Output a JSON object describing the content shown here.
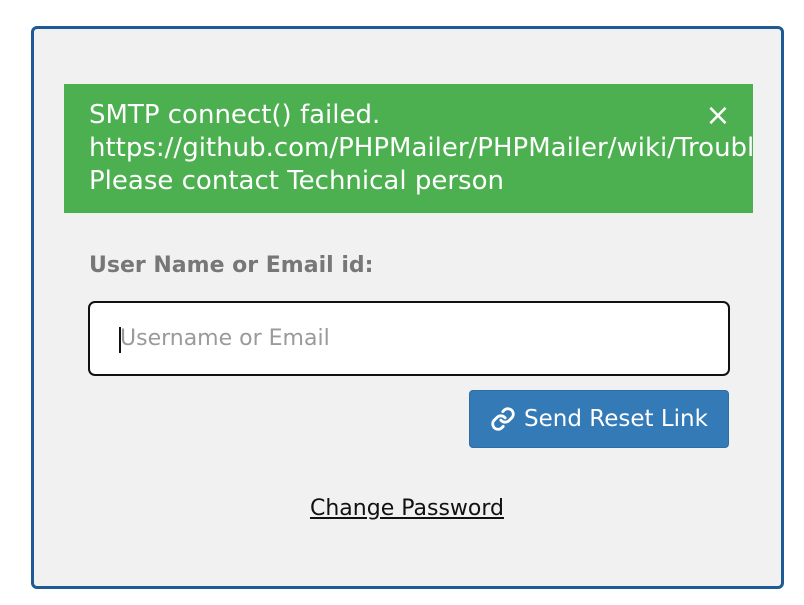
{
  "alert": {
    "lines": [
      "SMTP connect() failed.",
      "https://github.com/PHPMailer/PHPMailer/wiki/Troubleshooting",
      "Please contact Technical person"
    ],
    "close_label": "×",
    "color": "#4caf50"
  },
  "form": {
    "label": "User Name or Email id:",
    "input_placeholder": "Username or Email",
    "input_value": ""
  },
  "send_button": {
    "label": "Send Reset Link",
    "icon": "link-icon",
    "color": "#337ab7"
  },
  "change_password_link": {
    "label": "Change Password"
  },
  "panel": {
    "border_color": "#1e5b94",
    "background": "#f1f1f1"
  }
}
